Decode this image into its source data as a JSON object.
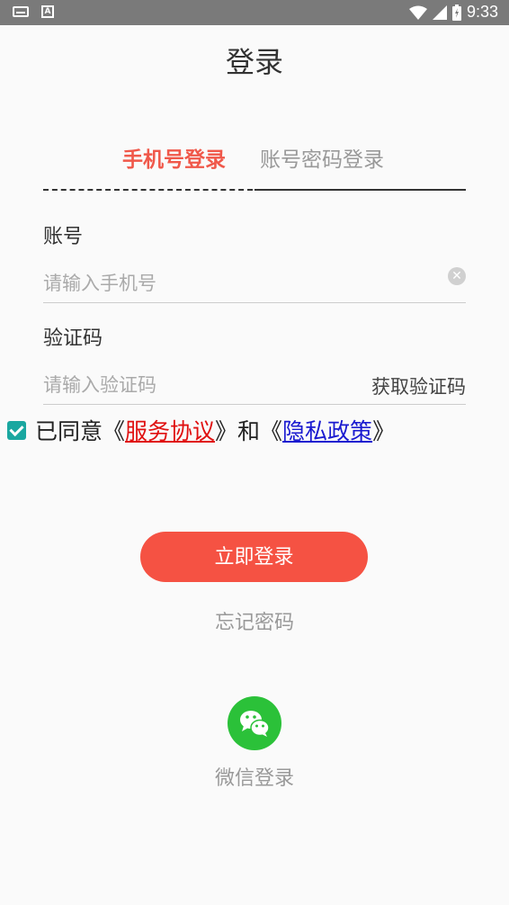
{
  "status_bar": {
    "time": "9:33",
    "icons": [
      "keyboard-icon",
      "a-icon",
      "wifi-icon",
      "signal-icon",
      "battery-icon"
    ]
  },
  "page": {
    "title": "登录"
  },
  "tabs": [
    {
      "label": "手机号登录",
      "active": true
    },
    {
      "label": "账号密码登录",
      "active": false
    }
  ],
  "account": {
    "label": "账号",
    "placeholder": "请输入手机号",
    "value": ""
  },
  "code": {
    "label": "验证码",
    "placeholder": "请输入验证码",
    "value": "",
    "get_code_label": "获取验证码"
  },
  "agreement": {
    "checked": true,
    "prefix": "已同意《",
    "service_link": "服务协议",
    "middle": "》和《",
    "privacy_link": "隐私政策",
    "suffix": "》"
  },
  "actions": {
    "login_label": "立即登录",
    "forgot_label": "忘记密码",
    "wechat_label": "微信登录"
  },
  "colors": {
    "accent": "#f55243",
    "active_tab": "#f0584a",
    "wechat": "#2bc139",
    "checkbox": "#1aa7a0"
  }
}
